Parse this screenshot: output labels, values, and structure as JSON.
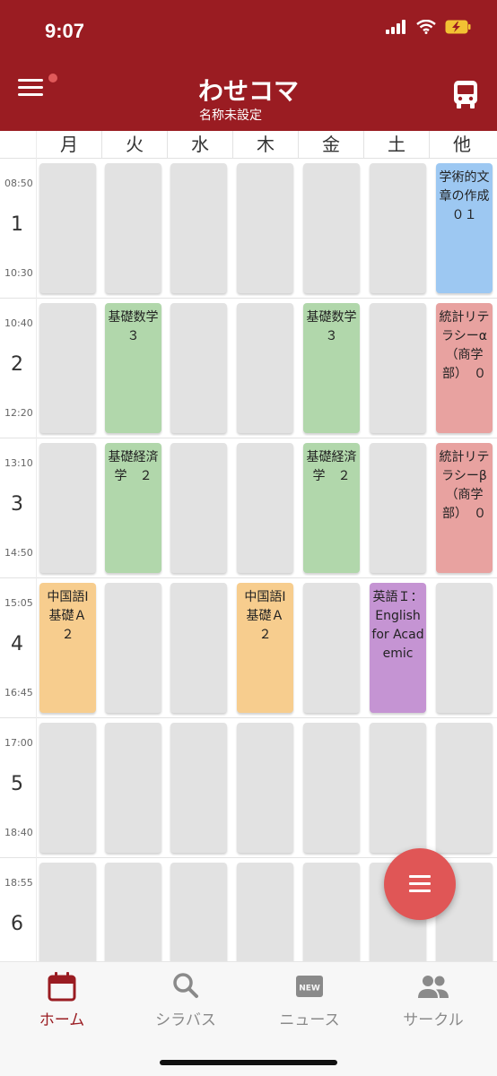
{
  "status_bar": {
    "time": "9:07"
  },
  "header": {
    "title": "わせコマ",
    "subtitle": "名称未設定"
  },
  "days": [
    "月",
    "火",
    "水",
    "木",
    "金",
    "土",
    "他"
  ],
  "periods": [
    {
      "num": "1",
      "start": "08:50",
      "end": "10:30"
    },
    {
      "num": "2",
      "start": "10:40",
      "end": "12:20"
    },
    {
      "num": "3",
      "start": "13:10",
      "end": "14:50"
    },
    {
      "num": "4",
      "start": "15:05",
      "end": "16:45"
    },
    {
      "num": "5",
      "start": "17:00",
      "end": "18:40"
    },
    {
      "num": "6",
      "start": "18:55",
      "end": ""
    }
  ],
  "courses": {
    "p1_sun": "学術的文章の作成０１",
    "p2_tue": "基礎数学３",
    "p2_fri": "基礎数学３",
    "p2_sun": "統計リテラシーα（商学部）　０",
    "p3_tue": "基礎経済学　２",
    "p3_fri": "基礎経済学　２",
    "p3_sun": "統計リテラシーβ（商学部）　０",
    "p4_mon": "中国語Ⅰ基礎Ａ　２",
    "p4_thu": "中国語Ⅰ基礎Ａ　２",
    "p4_sat": "英語Ｉ：English for Academic"
  },
  "colors": {
    "header": "#9a1c22",
    "empty_cell": "#e2e2e2",
    "green": "#b1d7ab",
    "blue": "#9dc8f2",
    "red": "#e8a2a0",
    "orange": "#f7cd8e",
    "purple": "#c594d3",
    "fab": "#e05656"
  },
  "bottom_nav": [
    {
      "label": "ホーム",
      "icon": "calendar-icon",
      "active": true
    },
    {
      "label": "シラバス",
      "icon": "search-icon",
      "active": false
    },
    {
      "label": "ニュース",
      "icon": "news-icon",
      "active": false
    },
    {
      "label": "サークル",
      "icon": "people-icon",
      "active": false
    }
  ]
}
